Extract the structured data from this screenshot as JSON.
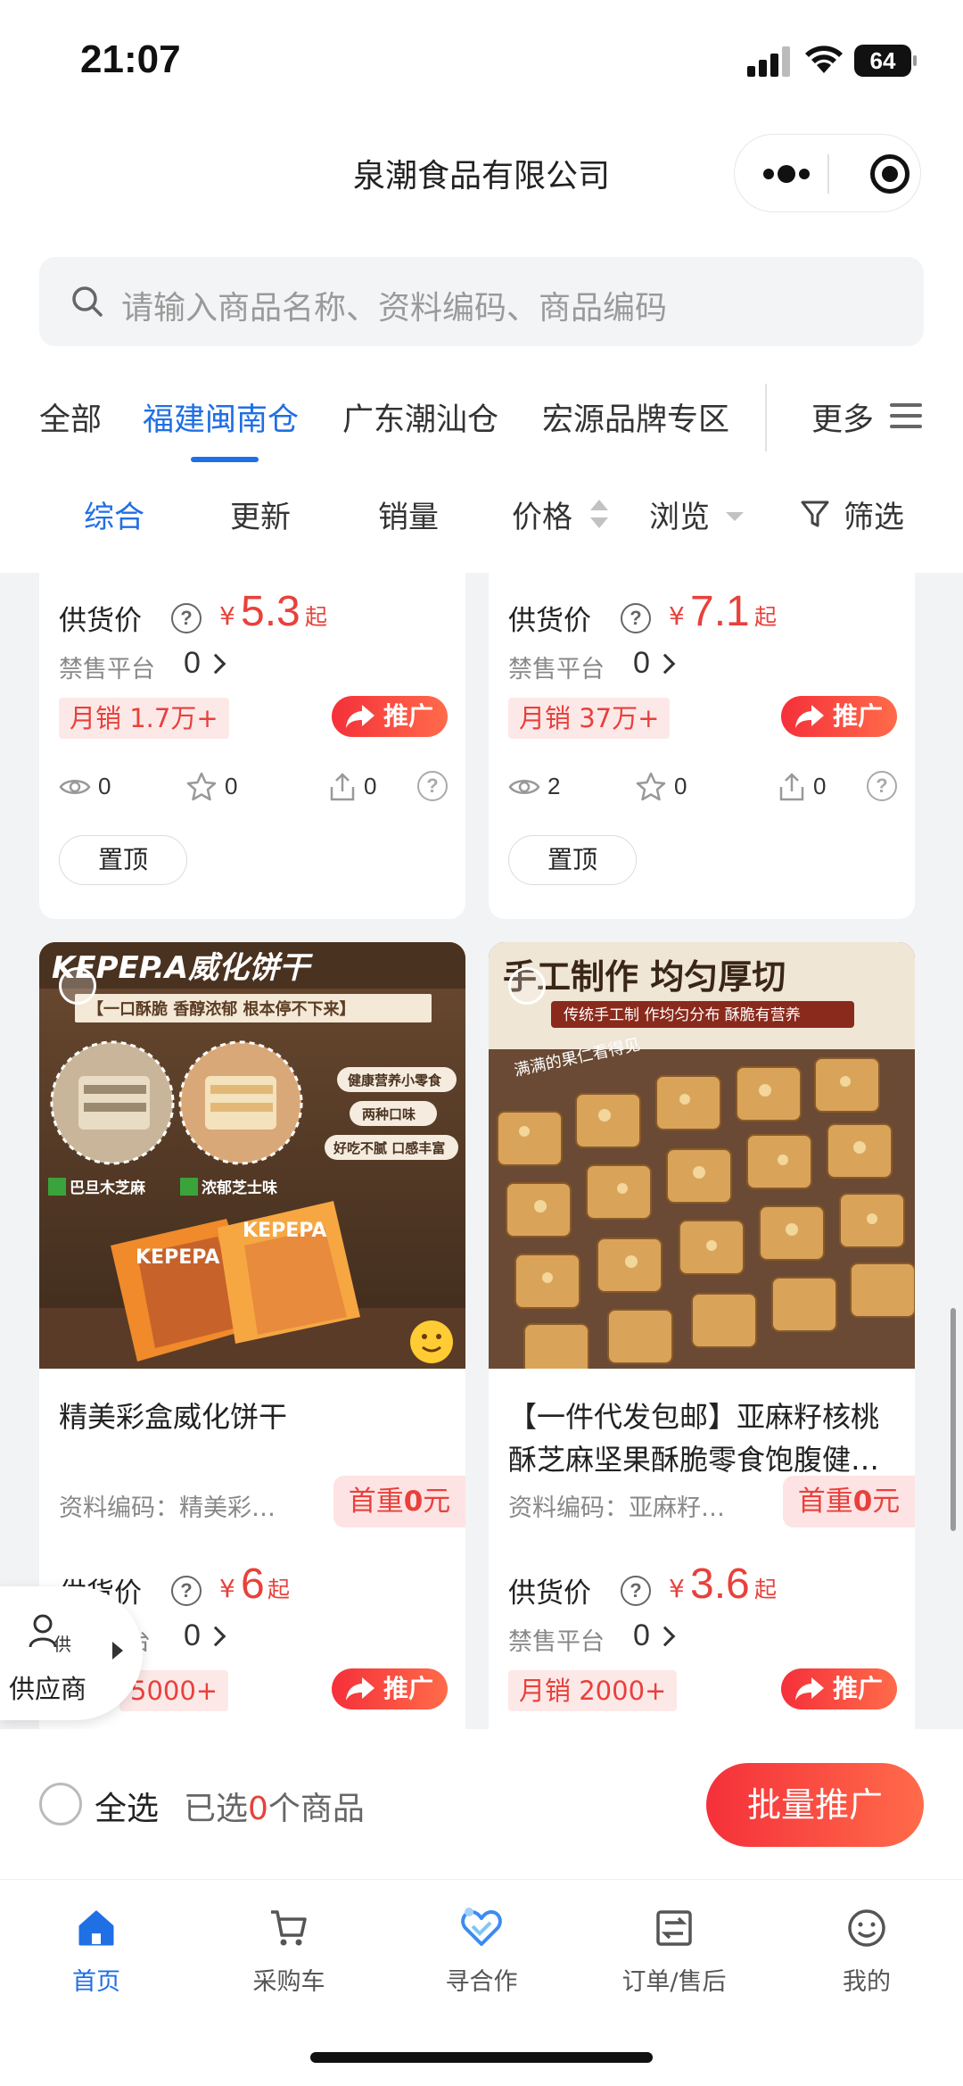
{
  "status": {
    "time": "21:07",
    "battery": "64"
  },
  "header": {
    "title": "泉潮食品有限公司"
  },
  "search": {
    "placeholder": "请输入商品名称、资料编码、商品编码"
  },
  "categories": {
    "items": [
      {
        "label": "全部"
      },
      {
        "label": "福建闽南仓"
      },
      {
        "label": "广东潮汕仓"
      },
      {
        "label": "宏源品牌专区"
      }
    ],
    "active_index": 1,
    "more_label": "更多"
  },
  "sort": {
    "items": [
      {
        "label": "综合"
      },
      {
        "label": "更新"
      },
      {
        "label": "销量"
      },
      {
        "label": "价格"
      },
      {
        "label": "浏览"
      }
    ],
    "active_index": 0,
    "filter_label": "筛选"
  },
  "products": [
    {
      "price_label": "供货价",
      "currency": "¥",
      "price": "5.3",
      "price_suffix": "起",
      "ban_label": "禁售平台",
      "ban_count": "0",
      "sales": "月销 1.7万+",
      "promo_label": "推广",
      "views": "0",
      "favorites": "0",
      "shares": "0",
      "pin_label": "置顶"
    },
    {
      "price_label": "供货价",
      "currency": "¥",
      "price": "7.1",
      "price_suffix": "起",
      "ban_label": "禁售平台",
      "ban_count": "0",
      "sales": "月销 37万+",
      "promo_label": "推广",
      "views": "2",
      "favorites": "0",
      "shares": "0",
      "pin_label": "置顶"
    },
    {
      "image": {
        "headline": "KEPEP.A威化饼干",
        "subline": "【一口酥脆 香醇浓郁 根本停不下来】",
        "tags": [
          "健康营养小零食",
          "两种口味",
          "好吃不腻 口感丰富"
        ],
        "flavors": [
          "巴旦木芝麻",
          "浓郁芝士味"
        ],
        "brand": "KEPEPA"
      },
      "title": "精美彩盒威化饼干",
      "code": "资料编码：精美彩…",
      "weight_prefix": "首重",
      "weight_value": "0",
      "weight_suffix": "元",
      "price_label": "供货价",
      "currency": "¥",
      "price": "6",
      "price_suffix": "起",
      "ban_label": "台",
      "ban_count": "0",
      "sales": "5000+",
      "promo_label": "推广"
    },
    {
      "image": {
        "headline": "手工制作 均匀厚切",
        "subline": "传统手工制 作均匀分布 酥脆有营养",
        "handwriting": "满满的果仁看得见"
      },
      "title": "【一件代发包邮】亚麻籽核桃酥芝麻坚果酥脆零食饱腹健…",
      "code": "资料编码：亚麻籽…",
      "weight_prefix": "首重",
      "weight_value": "0",
      "weight_suffix": "元",
      "price_label": "供货价",
      "currency": "¥",
      "price": "3.6",
      "price_suffix": "起",
      "ban_label": "禁售平台",
      "ban_count": "0",
      "sales": "月销 2000+",
      "promo_label": "推广"
    }
  ],
  "supplier": {
    "badge": "供",
    "label": "供应商"
  },
  "selection": {
    "all_label": "全选",
    "prefix": "已选",
    "count": "0",
    "suffix": "个商品",
    "batch_label": "批量推广"
  },
  "tabbar": {
    "items": [
      {
        "label": "首页",
        "icon": "home-icon"
      },
      {
        "label": "采购车",
        "icon": "cart-icon"
      },
      {
        "label": "寻合作",
        "icon": "heart-handshake-icon"
      },
      {
        "label": "订单/售后",
        "icon": "order-icon"
      },
      {
        "label": "我的",
        "icon": "smile-icon"
      }
    ],
    "active_index": 0
  },
  "colors": {
    "accent": "#1f6fe5",
    "price": "#e8413b",
    "brand_red": "#f5303a"
  }
}
